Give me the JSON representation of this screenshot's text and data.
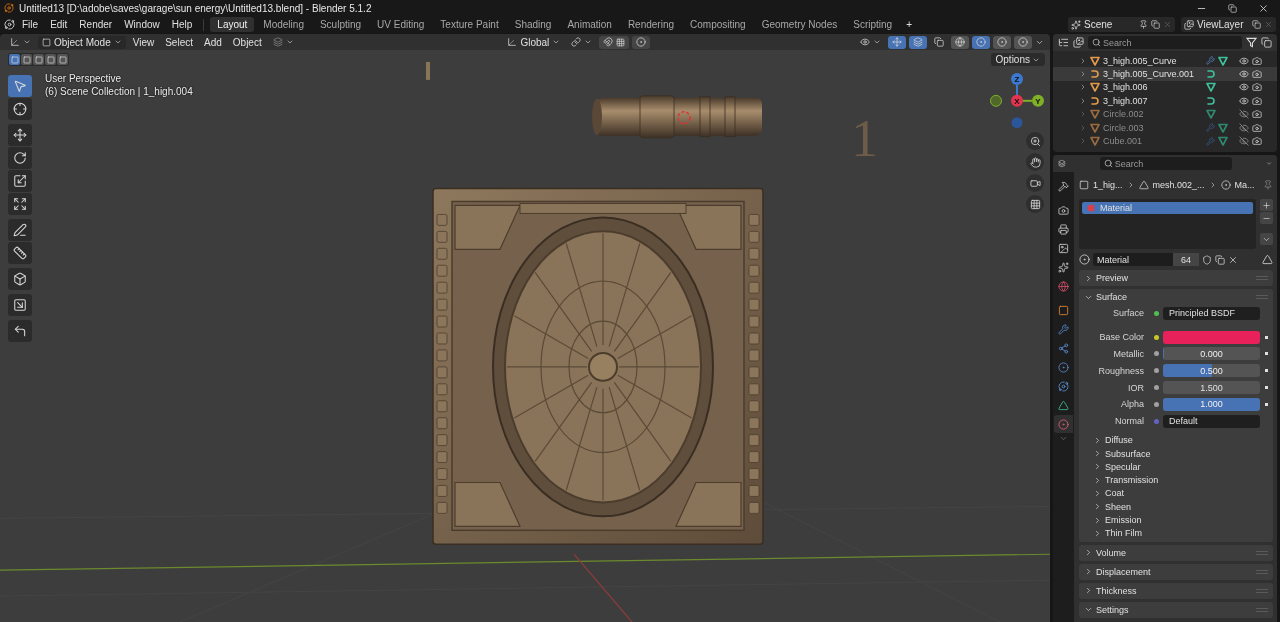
{
  "window": {
    "title": "Untitled13 [D:\\adobe\\saves\\garage\\sun energy\\Untitled13.blend] - Blender 5.1.2"
  },
  "menu": [
    "File",
    "Edit",
    "Render",
    "Window",
    "Help"
  ],
  "workspaces": [
    {
      "label": "Layout",
      "selected": true
    },
    {
      "label": "Modeling",
      "selected": false
    },
    {
      "label": "Sculpting",
      "selected": false
    },
    {
      "label": "UV Editing",
      "selected": false
    },
    {
      "label": "Texture Paint",
      "selected": false
    },
    {
      "label": "Shading",
      "selected": false
    },
    {
      "label": "Animation",
      "selected": false
    },
    {
      "label": "Rendering",
      "selected": false
    },
    {
      "label": "Compositing",
      "selected": false
    },
    {
      "label": "Geometry Nodes",
      "selected": false
    },
    {
      "label": "Scripting",
      "selected": false
    }
  ],
  "add_workspace": "+",
  "scene": {
    "scene_name": "Scene",
    "view_layer": "ViewLayer"
  },
  "viewport_header": {
    "mode": "Object Mode",
    "menus": [
      "View",
      "Select",
      "Add",
      "Object"
    ],
    "orientation": "Global",
    "options": "Options"
  },
  "shading_modes": [
    {
      "selected": false
    },
    {
      "selected": true
    },
    {
      "selected": false
    },
    {
      "selected": false
    }
  ],
  "select_modes": [
    {
      "selected": true
    },
    {
      "selected": false
    },
    {
      "selected": false
    },
    {
      "selected": false
    },
    {
      "selected": false
    }
  ],
  "tools": [
    {
      "selected": true
    },
    {
      "selected": false
    },
    {
      "selected": false
    },
    {
      "selected": false
    },
    {
      "selected": false
    },
    {
      "selected": false
    },
    {
      "selected": false
    },
    {
      "selected": false
    },
    {
      "selected": false
    },
    {
      "selected": false
    },
    {
      "selected": false
    }
  ],
  "viewport": {
    "view_name": "User Perspective",
    "collection_info": "(6) Scene Collection | 1_high.004",
    "scene_text_object": "1",
    "gizmo_axes": [
      "X",
      "Y",
      "Z"
    ]
  },
  "outliner": {
    "search_placeholder": "Search",
    "rows": [
      {
        "name": "3_high.005_Curve",
        "kind": "mesh",
        "modifier": true,
        "visible": true,
        "selected": false
      },
      {
        "name": "3_high.005_Curve.001",
        "kind": "curve",
        "modifier": false,
        "visible": true,
        "selected": true
      },
      {
        "name": "3_high.006",
        "kind": "mesh",
        "modifier": false,
        "visible": true,
        "selected": false
      },
      {
        "name": "3_high.007",
        "kind": "curve",
        "modifier": false,
        "visible": true,
        "selected": false
      },
      {
        "name": "Circle.002",
        "kind": "mesh",
        "modifier": false,
        "visible": false,
        "selected": false
      },
      {
        "name": "Circle.003",
        "kind": "mesh",
        "modifier": true,
        "visible": false,
        "selected": false
      },
      {
        "name": "Cube.001",
        "kind": "mesh",
        "modifier": true,
        "visible": false,
        "selected": false
      }
    ]
  },
  "properties": {
    "search_placeholder": "Search",
    "tabs": [
      {
        "selected": false
      },
      {
        "selected": false
      },
      {
        "selected": false
      },
      {
        "selected": false
      },
      {
        "selected": false
      },
      {
        "selected": false
      },
      {
        "selected": false
      },
      {
        "selected": false
      },
      {
        "selected": false
      },
      {
        "selected": false
      },
      {
        "selected": false
      },
      {
        "selected": false
      },
      {
        "selected": true
      }
    ],
    "breadcrumb": [
      "1_hig...",
      "mesh.002_...",
      "Ma..."
    ],
    "slots": [
      {
        "name": "Material",
        "selected": true
      }
    ],
    "material": {
      "name": "Material",
      "users": "64"
    },
    "panels": [
      {
        "title": "Preview",
        "expanded": false
      },
      {
        "title": "Surface",
        "expanded": true,
        "fields": [
          {
            "label": "Surface",
            "kind": "shader",
            "value": "Principled BSDF"
          },
          {
            "label": "Base Color",
            "kind": "color",
            "color": "#e8215a"
          },
          {
            "label": "Metallic",
            "kind": "slider",
            "value": "0.000",
            "level": 0
          },
          {
            "label": "Roughness",
            "kind": "slider",
            "value": "0.500",
            "level": 0.5
          },
          {
            "label": "IOR",
            "kind": "number",
            "value": "1.500"
          },
          {
            "label": "Alpha",
            "kind": "slider",
            "value": "1.000",
            "level": 1
          },
          {
            "label": "Normal",
            "kind": "vector",
            "value": "Default"
          }
        ],
        "subpanels": [
          {
            "title": "Diffuse",
            "expanded": false
          },
          {
            "title": "Subsurface",
            "expanded": false
          },
          {
            "title": "Specular",
            "expanded": false
          },
          {
            "title": "Transmission",
            "expanded": false
          },
          {
            "title": "Coat",
            "expanded": false
          },
          {
            "title": "Sheen",
            "expanded": false
          },
          {
            "title": "Emission",
            "expanded": false
          },
          {
            "title": "Thin Film",
            "expanded": false
          }
        ]
      },
      {
        "title": "Volume",
        "expanded": false
      },
      {
        "title": "Displacement",
        "expanded": false
      },
      {
        "title": "Thickness",
        "expanded": false
      },
      {
        "title": "Settings",
        "expanded": true
      }
    ]
  }
}
